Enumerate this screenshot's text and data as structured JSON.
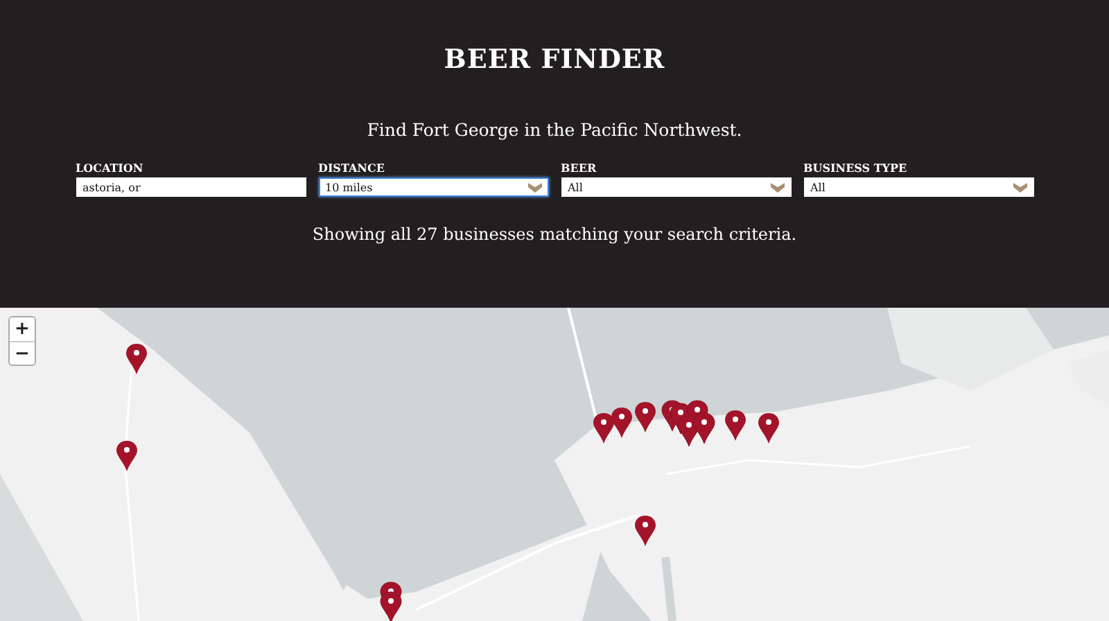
{
  "header": {
    "title": "BEER FINDER",
    "subtitle": "Find Fort George in the Pacific Northwest."
  },
  "filters": [
    {
      "label": "LOCATION",
      "kind": "text",
      "value": "astoria, or",
      "focused": false
    },
    {
      "label": "DISTANCE",
      "kind": "select",
      "value": "10 miles",
      "focused": true
    },
    {
      "label": "BEER",
      "kind": "select",
      "value": "All",
      "focused": false
    },
    {
      "label": "BUSINESS TYPE",
      "kind": "select",
      "value": "All",
      "focused": false
    }
  ],
  "result_text": "Showing all 27 businesses matching your search criteria.",
  "map": {
    "kind": "picture",
    "zoom_controls": [
      "+",
      "−"
    ]
  }
}
